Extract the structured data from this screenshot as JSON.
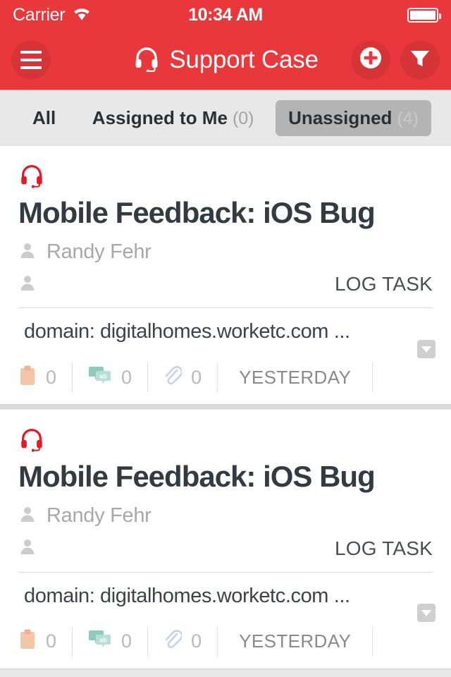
{
  "status_bar": {
    "carrier": "Carrier",
    "wifi_icon": "wifi-icon",
    "time": "10:34 AM",
    "battery_icon": "battery-full-icon"
  },
  "nav": {
    "menu_icon": "hamburger-menu-icon",
    "title_icon": "headset-icon",
    "title": "Support Case",
    "add_icon": "plus-circle-icon",
    "filter_icon": "funnel-filter-icon",
    "background_color": "#e8383c"
  },
  "tabs": [
    {
      "label": "All",
      "count": "",
      "selected": false
    },
    {
      "label": "Assigned to Me",
      "count": "(0)",
      "selected": false
    },
    {
      "label": "Unassigned",
      "count": "(4)",
      "selected": true
    }
  ],
  "cards": [
    {
      "type_icon": "headset-icon",
      "title": "Mobile Feedback: iOS Bug",
      "contact_icon": "person-icon",
      "contact_name": "Randy Fehr",
      "assignee_icon": "person-icon",
      "assignee_name": "",
      "action_label": "LOG TASK",
      "description": "domain: digitalhomes.worketc.com ...",
      "expand_icon": "chevron-down-icon",
      "stats": [
        {
          "icon": "clipboard-icon",
          "value": "0",
          "color": "#f5c5a8"
        },
        {
          "icon": "comment-ab-icon",
          "value": "0",
          "color": "#b9ded6"
        },
        {
          "icon": "paperclip-icon",
          "value": "0",
          "color": "#c3d3ea"
        }
      ],
      "date": "YESTERDAY"
    },
    {
      "type_icon": "headset-icon",
      "title": "Mobile Feedback: iOS Bug",
      "contact_icon": "person-icon",
      "contact_name": "Randy Fehr",
      "assignee_icon": "person-icon",
      "assignee_name": "",
      "action_label": "LOG TASK",
      "description": "domain: digitalhomes.worketc.com ...",
      "expand_icon": "chevron-down-icon",
      "stats": [
        {
          "icon": "clipboard-icon",
          "value": "0",
          "color": "#f5c5a8"
        },
        {
          "icon": "comment-ab-icon",
          "value": "0",
          "color": "#b9ded6"
        },
        {
          "icon": "paperclip-icon",
          "value": "0",
          "color": "#c3d3ea"
        }
      ],
      "date": "YESTERDAY"
    }
  ]
}
